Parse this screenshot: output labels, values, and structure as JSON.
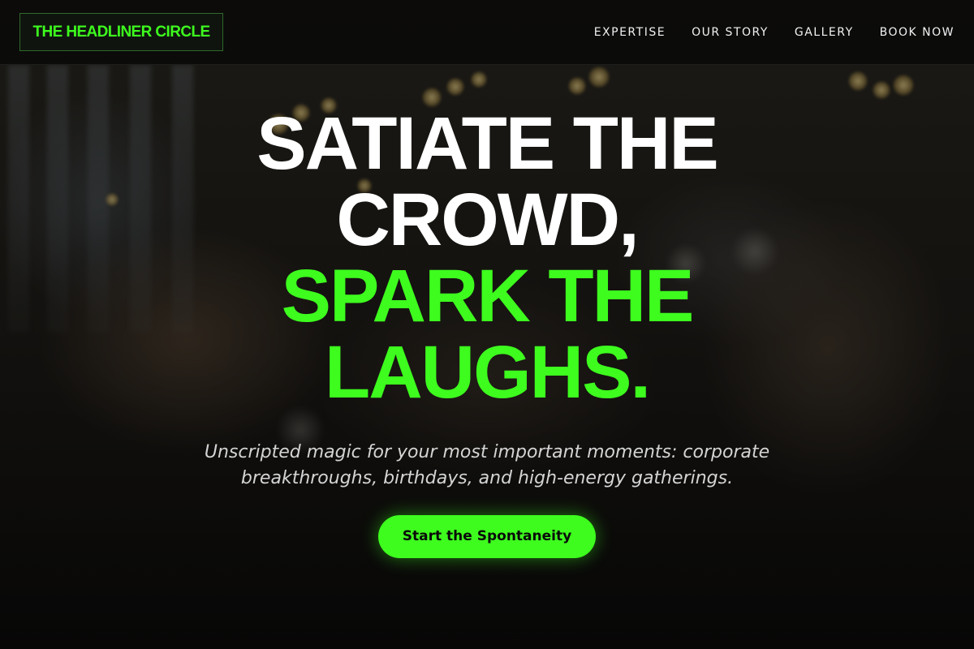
{
  "brand": {
    "name": "THE HEADLINER CIRCLE",
    "accent": "#3dfc1e"
  },
  "nav": {
    "items": [
      {
        "label": "EXPERTISE"
      },
      {
        "label": "OUR STORY"
      },
      {
        "label": "GALLERY"
      },
      {
        "label": "BOOK NOW"
      }
    ]
  },
  "hero": {
    "headline_white_1": "SATIATE THE",
    "headline_white_2": "CROWD,",
    "headline_green_1": "SPARK THE",
    "headline_green_2": "LAUGHS.",
    "subtitle": "Unscripted magic for your most important moments: corporate breakthroughs, birthdays, and high-energy gatherings.",
    "cta_label": "Start the Spontaneity"
  }
}
